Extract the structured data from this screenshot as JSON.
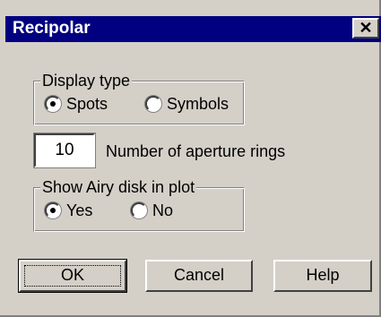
{
  "window": {
    "title": "Recipolar",
    "close_glyph": "✕"
  },
  "display_type": {
    "legend": "Display type",
    "options": [
      {
        "label": "Spots",
        "selected": true
      },
      {
        "label": "Symbols",
        "selected": false
      }
    ]
  },
  "aperture": {
    "value": "10",
    "label": "Number of aperture rings"
  },
  "airy": {
    "legend": "Show Airy disk in plot",
    "options": [
      {
        "label": "Yes",
        "selected": true
      },
      {
        "label": "No",
        "selected": false
      }
    ]
  },
  "buttons": {
    "ok": "OK",
    "cancel": "Cancel",
    "help": "Help"
  }
}
